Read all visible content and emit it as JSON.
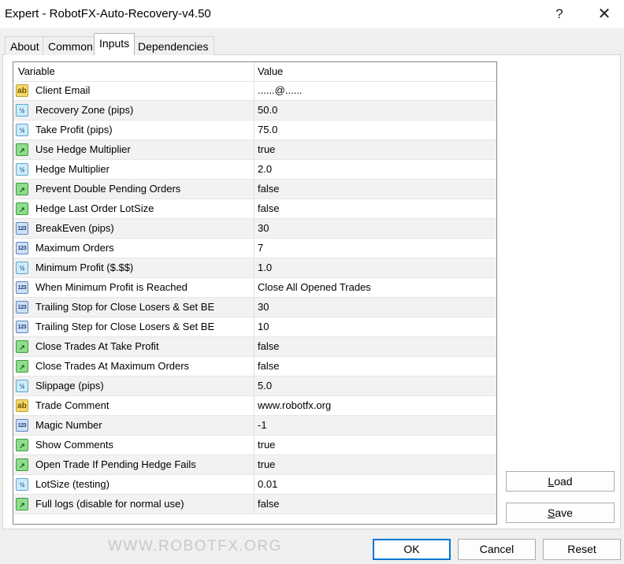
{
  "window": {
    "title": "Expert - RobotFX-Auto-Recovery-v4.50",
    "help": "?",
    "close": "✕"
  },
  "tabs": [
    {
      "label": "About",
      "active": false
    },
    {
      "label": "Common",
      "active": false
    },
    {
      "label": "Inputs",
      "active": true
    },
    {
      "label": "Dependencies",
      "active": false
    }
  ],
  "grid": {
    "headers": {
      "variable": "Variable",
      "value": "Value"
    },
    "rows": [
      {
        "type": "ab",
        "icon_text": "ab",
        "name": "Client Email",
        "value": "......@......"
      },
      {
        "type": "dbl",
        "icon_text": "½",
        "name": "Recovery Zone (pips)",
        "value": "50.0"
      },
      {
        "type": "dbl",
        "icon_text": "½",
        "name": "Take Profit (pips)",
        "value": "75.0"
      },
      {
        "type": "bool",
        "icon_text": "↗",
        "name": "Use Hedge Multiplier",
        "value": "true"
      },
      {
        "type": "dbl",
        "icon_text": "½",
        "name": "Hedge Multiplier",
        "value": "2.0"
      },
      {
        "type": "bool",
        "icon_text": "↗",
        "name": "Prevent Double Pending Orders",
        "value": "false"
      },
      {
        "type": "bool",
        "icon_text": "↗",
        "name": "Hedge Last Order LotSize",
        "value": "false"
      },
      {
        "type": "int",
        "icon_text": "123",
        "name": "BreakEven (pips)",
        "value": "30"
      },
      {
        "type": "int",
        "icon_text": "123",
        "name": "Maximum Orders",
        "value": "7"
      },
      {
        "type": "dbl",
        "icon_text": "½",
        "name": "Minimum Profit ($.$$)",
        "value": "1.0"
      },
      {
        "type": "int",
        "icon_text": "123",
        "name": "When Minimum Profit is Reached",
        "value": "Close All Opened Trades"
      },
      {
        "type": "int",
        "icon_text": "123",
        "name": "Trailing Stop for Close Losers & Set BE",
        "value": "30"
      },
      {
        "type": "int",
        "icon_text": "123",
        "name": "Trailing Step for Close Losers & Set BE",
        "value": "10"
      },
      {
        "type": "bool",
        "icon_text": "↗",
        "name": "Close Trades At Take Profit",
        "value": "false"
      },
      {
        "type": "bool",
        "icon_text": "↗",
        "name": "Close Trades At Maximum Orders",
        "value": "false"
      },
      {
        "type": "dbl",
        "icon_text": "½",
        "name": "Slippage (pips)",
        "value": "5.0"
      },
      {
        "type": "ab",
        "icon_text": "ab",
        "name": "Trade Comment",
        "value": "www.robotfx.org"
      },
      {
        "type": "int",
        "icon_text": "123",
        "name": "Magic Number",
        "value": "-1"
      },
      {
        "type": "bool",
        "icon_text": "↗",
        "name": "Show Comments",
        "value": "true"
      },
      {
        "type": "bool",
        "icon_text": "↗",
        "name": "Open Trade If Pending Hedge Fails",
        "value": "true"
      },
      {
        "type": "dbl",
        "icon_text": "½",
        "name": "LotSize (testing)",
        "value": "0.01"
      },
      {
        "type": "bool",
        "icon_text": "↗",
        "name": "Full logs (disable for normal use)",
        "value": "false"
      }
    ]
  },
  "side_buttons": {
    "load": {
      "accel": "L",
      "rest": "oad"
    },
    "save": {
      "accel": "S",
      "rest": "ave"
    }
  },
  "bottom_buttons": {
    "ok": "OK",
    "cancel": "Cancel",
    "reset": "Reset"
  },
  "watermark": "WWW.ROBOTFX.ORG",
  "colors": {
    "ok_border": "#0078d4",
    "alt_row": "#f2f2f2",
    "grid_border": "#828790"
  }
}
